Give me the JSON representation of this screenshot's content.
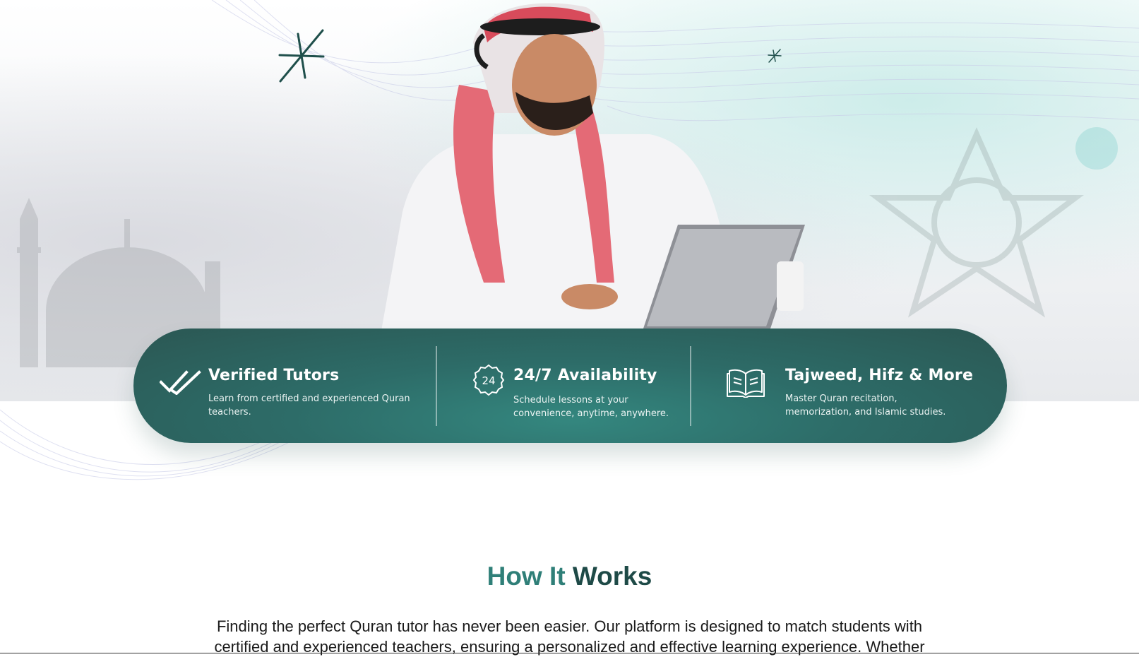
{
  "features": [
    {
      "icon": "double-check-icon",
      "title": "Verified Tutors",
      "desc_line1": "Learn from certified and experienced Quran",
      "desc_line2": "teachers."
    },
    {
      "icon": "clock-24-badge-icon",
      "badge_text": "24",
      "title": "24/7 Availability",
      "desc_line1": "Schedule lessons at your",
      "desc_line2": "convenience, anytime, anywhere."
    },
    {
      "icon": "open-book-icon",
      "title": "Tajweed, Hifz & More",
      "desc_line1": "Master Quran recitation,",
      "desc_line2": "memorization, and Islamic studies."
    }
  ],
  "how_it_works": {
    "title_part1": "How It",
    "title_part2": "Works",
    "text_line1": "Finding the perfect Quran tutor has never been easier. Our platform is designed to match students with",
    "text_line2": "certified and experienced teachers, ensuring a personalized and effective learning experience. Whether"
  },
  "colors": {
    "feature_bar": "#2d6c68",
    "title_dark": "#1e4a47",
    "title_accent": "#2f7f78"
  }
}
